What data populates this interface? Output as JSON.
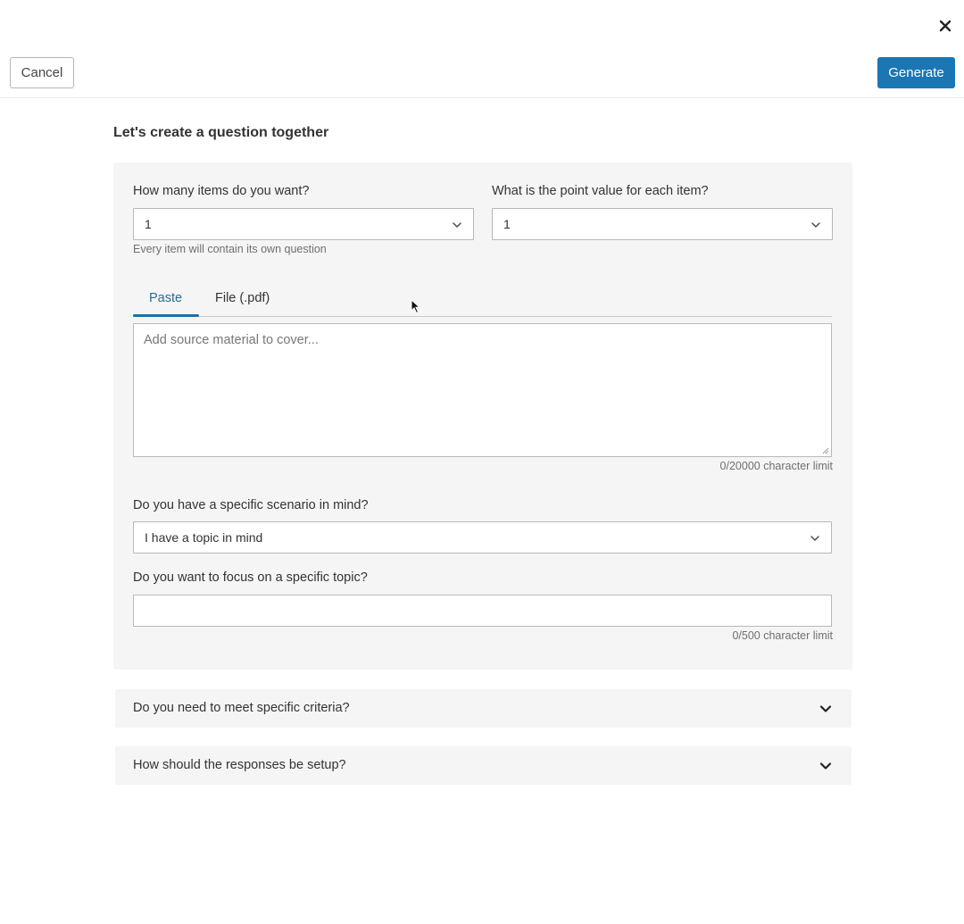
{
  "header": {
    "cancel_label": "Cancel",
    "generate_label": "Generate"
  },
  "page_title": "Let's create a question together",
  "items": {
    "label": "How many items do you want?",
    "value": "1",
    "hint": "Every item will contain its own question"
  },
  "points": {
    "label": "What is the point value for each item?",
    "value": "1"
  },
  "tabs": {
    "paste_label": "Paste",
    "file_label": "File (.pdf)",
    "active": "Paste"
  },
  "source": {
    "placeholder": "Add source material to cover...",
    "limit_text": "0/20000 character limit"
  },
  "scenario": {
    "label": "Do you have a specific scenario in mind?",
    "value": "I have a topic in mind"
  },
  "topic": {
    "label": "Do you want to focus on a specific topic?",
    "value": "",
    "limit_text": "0/500 character limit"
  },
  "accordions": [
    {
      "label": "Do you need to meet specific criteria?"
    },
    {
      "label": "How should the responses be setup?"
    }
  ],
  "colors": {
    "accent": "#1a77b4",
    "active_tab": "#2b6a94",
    "panel_bg": "#f5f5f5"
  },
  "icons": {
    "close": "close-icon",
    "chevron": "chevron-down-icon",
    "cursor": "mouse-cursor-icon"
  }
}
